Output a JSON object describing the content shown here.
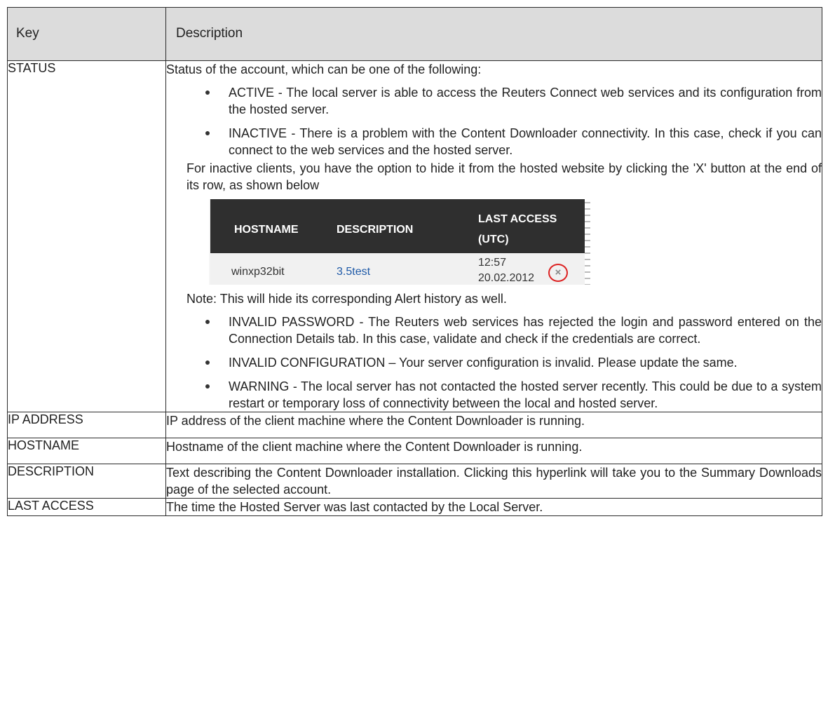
{
  "header": {
    "key": "Key",
    "description": "Description"
  },
  "status_row": {
    "key": "STATUS",
    "intro": "Status of the account, which can be one of the following:",
    "bullets_a": [
      "ACTIVE - The local server is able to access the Reuters Connect web services and its configuration from the hosted server.",
      "INACTIVE - There is a problem with the Content Downloader connectivity. In this case, check if you can connect to the web services and the hosted server."
    ],
    "inactive_note": "For inactive clients, you have the option to hide it from the hosted website by clicking the 'X' button at the end of its row, as shown below",
    "screenshot": {
      "col_hostname": "HOSTNAME",
      "col_description": "DESCRIPTION",
      "col_last_access_1": "LAST ACCESS",
      "col_last_access_2": "(UTC)",
      "row_hostname": "winxp32bit",
      "row_description": "3.5test",
      "row_time": "12:57",
      "row_date": "20.02.2012",
      "hide_glyph": "×"
    },
    "hide_note": "Note: This will hide its corresponding Alert history as well.",
    "bullets_b": [
      "INVALID PASSWORD - The Reuters web services has rejected the login and password entered on the Connection Details tab. In this case, validate and check if the credentials are correct.",
      "INVALID CONFIGURATION – Your server configuration is invalid. Please update the same.",
      "WARNING - The local server has not contacted the hosted server recently. This could be due to a system restart or temporary loss of connectivity between the local and hosted server."
    ]
  },
  "rows": [
    {
      "key": "IP ADDRESS",
      "description": "IP address of the client machine where the Content Downloader is running."
    },
    {
      "key": "HOSTNAME",
      "description": "Hostname of the client machine where the Content Downloader is running."
    },
    {
      "key": "DESCRIPTION",
      "description": "Text describing the Content Downloader installation. Clicking this hyperlink will take you to the Summary Downloads page of the selected account."
    },
    {
      "key": "LAST ACCESS",
      "description": "The time the Hosted Server was last contacted by the Local Server."
    }
  ]
}
